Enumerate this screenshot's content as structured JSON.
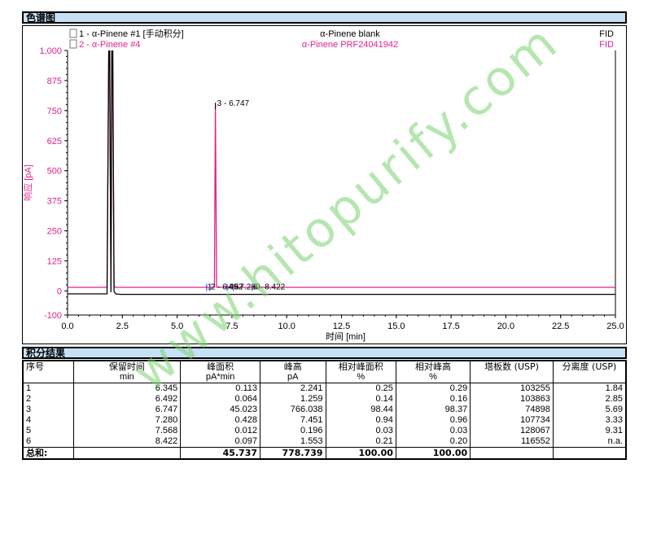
{
  "report": {
    "chrom_section_title": "色谱图",
    "results_section_title": "积分结果"
  },
  "legend": [
    {
      "name": "1 - α-Pinene #1 [手动积分]",
      "sample": "α-Pinene blank",
      "detector": "FID",
      "color": "#000000"
    },
    {
      "name": "2 - α-Pinene #4",
      "sample": "α-Pinene PRF24041942",
      "detector": "FID",
      "color": "#e0218a"
    }
  ],
  "chart_data": {
    "type": "line",
    "xlabel": "时间 [min]",
    "ylabel": "响应 [pA]",
    "xlim": [
      0.0,
      25.0
    ],
    "ylim": [
      -100,
      1000
    ],
    "xticks": [
      "0.0",
      "2.5",
      "5.0",
      "7.5",
      "10.0",
      "12.5",
      "15.0",
      "17.5",
      "20.0",
      "22.5",
      "25.0"
    ],
    "yticks": [
      "-100",
      "0",
      "125",
      "250",
      "375",
      "500",
      "625",
      "750",
      "875",
      "1,000"
    ],
    "series": [
      {
        "name": "1 - α-Pinene #1 [手动积分]",
        "x": [
          0.0,
          1.8,
          1.88,
          1.92,
          1.98,
          2.02,
          2.06,
          2.12,
          2.2,
          2.4,
          25.0
        ],
        "y": [
          -12,
          -12,
          1000,
          1000,
          -5,
          1000,
          1000,
          -2,
          -12,
          -14,
          -14
        ]
      },
      {
        "name": "2 - α-Pinene #4",
        "x": [
          0.0,
          1.8,
          1.88,
          1.92,
          1.98,
          2.02,
          2.06,
          2.12,
          2.2,
          6.3,
          6.345,
          6.4,
          6.45,
          6.492,
          6.53,
          6.7,
          6.747,
          6.8,
          7.24,
          7.28,
          7.32,
          7.54,
          7.568,
          7.6,
          8.38,
          8.422,
          8.46,
          25.0
        ],
        "y": [
          15,
          15,
          1000,
          1000,
          20,
          1000,
          1000,
          20,
          15,
          15,
          17,
          15,
          15,
          16,
          15,
          15,
          781,
          15,
          15,
          22,
          15,
          15,
          15,
          15,
          15,
          16,
          15,
          15
        ]
      }
    ],
    "peak_labels": [
      {
        "x": 6.747,
        "y": 766.038,
        "text": "3 - 6.747"
      },
      {
        "x": 6.345,
        "y": 2.241,
        "text": "1"
      },
      {
        "x": 6.492,
        "y": 1.259,
        "text": "2 - 6.492"
      },
      {
        "x": 7.28,
        "y": 7.451,
        "text": "4 - 7.280"
      },
      {
        "x": 7.568,
        "y": 0.196,
        "text": "5"
      },
      {
        "x": 8.422,
        "y": 1.553,
        "text": "6 - 8.422"
      }
    ],
    "grid": false
  },
  "results": {
    "headers": [
      "序号",
      "保留时间",
      "峰面积",
      "峰高",
      "相对峰面积",
      "相对峰高",
      "塔板数 (USP)",
      "分离度 (USP)"
    ],
    "units": [
      "",
      "min",
      "pA*min",
      "pA",
      "%",
      "%",
      "",
      ""
    ],
    "rows": [
      [
        "1",
        "6.345",
        "0.113",
        "2.241",
        "0.25",
        "0.29",
        "103255",
        "1.84"
      ],
      [
        "2",
        "6.492",
        "0.064",
        "1.259",
        "0.14",
        "0.16",
        "103863",
        "2.85"
      ],
      [
        "3",
        "6.747",
        "45.023",
        "766.038",
        "98.44",
        "98.37",
        "74898",
        "5.69"
      ],
      [
        "4",
        "7.280",
        "0.428",
        "7.451",
        "0.94",
        "0.96",
        "107734",
        "3.33"
      ],
      [
        "5",
        "7.568",
        "0.012",
        "0.196",
        "0.03",
        "0.03",
        "128067",
        "9.31"
      ],
      [
        "6",
        "8.422",
        "0.097",
        "1.553",
        "0.21",
        "0.20",
        "116552",
        "n.a."
      ]
    ],
    "total": [
      "总和:",
      "",
      "45.737",
      "778.739",
      "100.00",
      "100.00",
      "",
      ""
    ]
  },
  "watermark": "www.hitopurify.com"
}
